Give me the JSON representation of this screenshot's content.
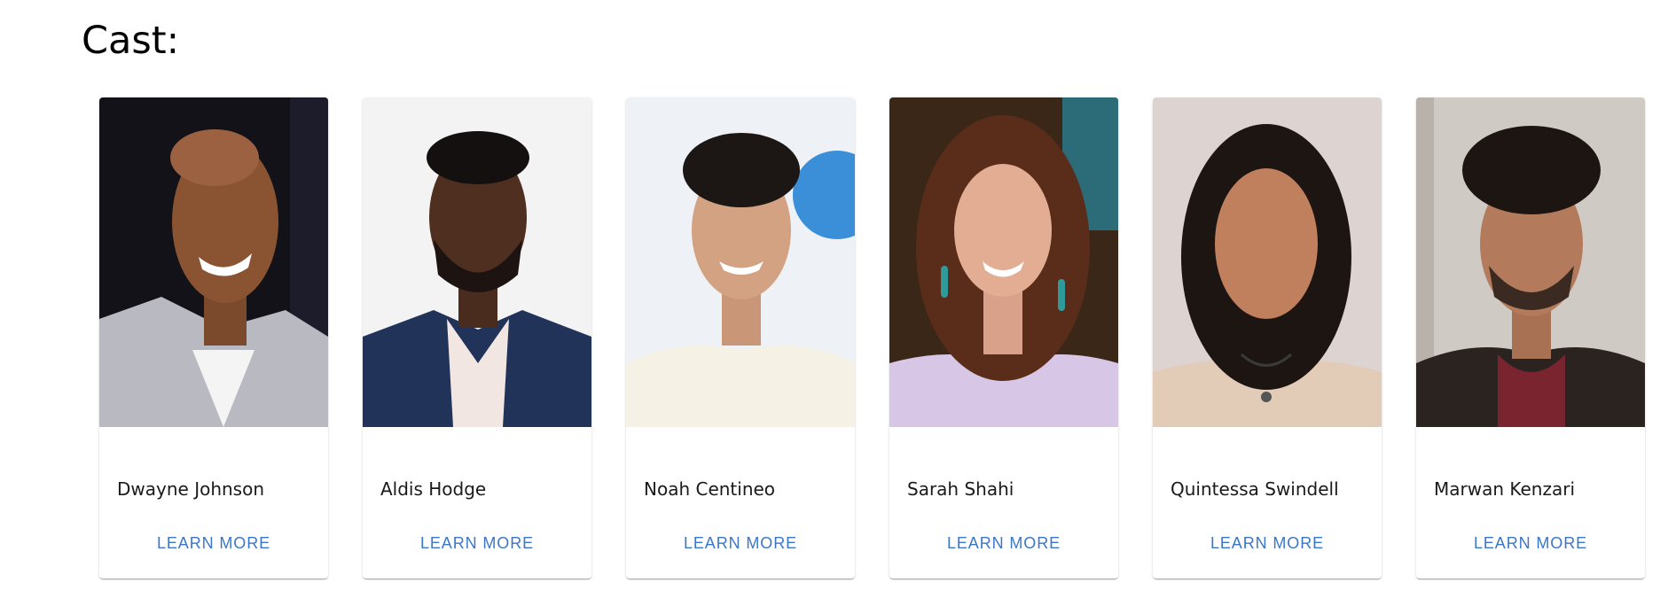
{
  "page": {
    "title": "Cast:"
  },
  "cast": [
    {
      "name": "Dwayne Johnson",
      "action": "LEARN MORE"
    },
    {
      "name": "Aldis Hodge",
      "action": "LEARN MORE"
    },
    {
      "name": "Noah Centineo",
      "action": "LEARN MORE"
    },
    {
      "name": "Sarah Shahi",
      "action": "LEARN MORE"
    },
    {
      "name": "Quintessa Swindell",
      "action": "LEARN MORE"
    },
    {
      "name": "Marwan Kenzari",
      "action": "LEARN MORE"
    }
  ],
  "colors": {
    "accent": "#3b76c9",
    "text": "#1a1a1a"
  }
}
